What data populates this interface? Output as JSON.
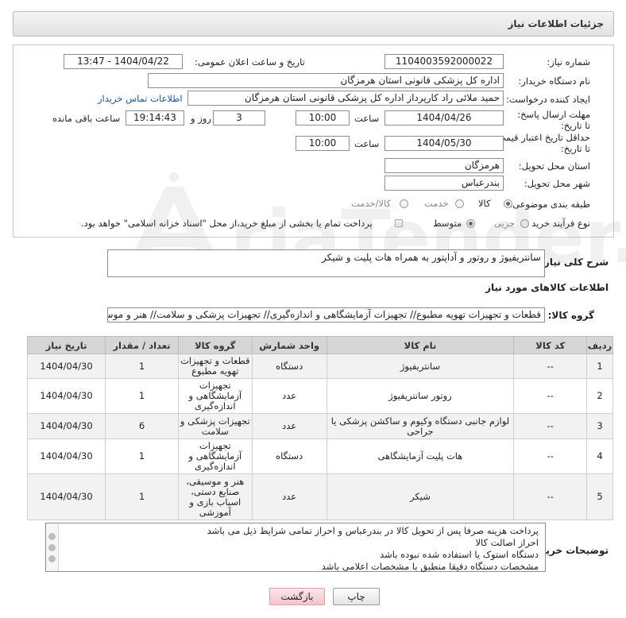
{
  "header": {
    "title": "جزئیات اطلاعات نیاز"
  },
  "form": {
    "need_number_label": "شماره نیاز:",
    "need_number": "1104003592000022",
    "announce_label": "تاریخ و ساعت اعلان عمومی:",
    "announce_value": "1404/04/22 - 13:47",
    "buyer_org_label": "نام دستگاه خریدار:",
    "buyer_org": "اداره کل پزشکی قانونی استان هرمزگان",
    "creator_label": "ایجاد کننده درخواست:",
    "creator": "حمید ملائی راد کارپرداز اداره کل پزشکی قانونی استان هرمزگان",
    "buyer_contact_link": "اطلاعات تماس خریدار",
    "reply_deadline_label": "مهلت ارسال پاسخ: تا تاریخ:",
    "reply_date": "1404/04/26",
    "time_label": "ساعت",
    "reply_time": "10:00",
    "days_value": "3",
    "days_label": "روز و",
    "remaining_time": "19:14:43",
    "remaining_label": "ساعت باقی مانده",
    "validity_label": "حداقل تاریخ اعتبار قیمت: تا تاریخ:",
    "validity_date": "1404/05/30",
    "validity_time": "10:00",
    "province_label": "استان محل تحویل:",
    "province": "هرمزگان",
    "city_label": "شهر محل تحویل:",
    "city": "بندرعباس",
    "category_label": "طبقه بندی موضوعی:",
    "category_options": [
      "کالا",
      "خدمت",
      "کالا/خدمت"
    ],
    "purchase_type_label": "نوع فرآیند خرید :",
    "purchase_type_options": [
      "جزیی",
      "متوسط"
    ],
    "payment_note": "پرداخت تمام یا بخشی از مبلغ خرید،از محل \"اسناد خزانه اسلامی\" خواهد بود."
  },
  "summary": {
    "label": "شرح کلی نیاز:",
    "text": "سانتریفیوژ و روتور و آداپتور به همراه هات پلیت و شیکر"
  },
  "goods": {
    "section_title": "اطلاعات کالاهای مورد نیاز",
    "group_label": "گروه کالا:",
    "group_value": "قطعات و تجهیزات تهویه مطبوع// تجهیزات آزمایشگاهی و اندازه‌گیری// تجهیزات پزشکی و سلامت// هنر و موس"
  },
  "table": {
    "headers": [
      "ردیف",
      "کد کالا",
      "نام کالا",
      "واحد شمارش",
      "گروه کالا",
      "تعداد / مقدار",
      "تاریخ نیاز"
    ],
    "rows": [
      {
        "row": "1",
        "code": "--",
        "name": "سانتریفیوژ",
        "unit": "دستگاه",
        "group": "قطعات و تجهیزات تهویه مطبوع",
        "qty": "1",
        "date": "1404/04/30"
      },
      {
        "row": "2",
        "code": "--",
        "name": "روتور سانتریفیوژ",
        "unit": "عدد",
        "group": "تجهیزات آزمایشگاهی و اندازه‌گیری",
        "qty": "1",
        "date": "1404/04/30"
      },
      {
        "row": "3",
        "code": "--",
        "name": "لوازم جانبی دستگاه وکیوم و ساکشن پزشکی یا جراحی",
        "unit": "عدد",
        "group": "تجهیزات پزشکی و سلامت",
        "qty": "6",
        "date": "1404/04/30"
      },
      {
        "row": "4",
        "code": "--",
        "name": "هات پلیت آزمایشگاهی",
        "unit": "دستگاه",
        "group": "تجهیزات آزمایشگاهی و اندازه‌گیری",
        "qty": "1",
        "date": "1404/04/30"
      },
      {
        "row": "5",
        "code": "--",
        "name": "شیکر",
        "unit": "عدد",
        "group": "هنر و موسیقی، صنایع دستی، اسباب بازی و آموزشی",
        "qty": "1",
        "date": "1404/04/30"
      }
    ]
  },
  "notes": {
    "label": "توضیحات خریدار:",
    "lines": [
      "پرداخت هزینه صرفا پس از تحویل کالا در بندرعباس و احراز تمامی شرایط ذیل می باشد",
      "احراز اصالت کالا",
      "دستگاه استوک یا استفاده شده نبوده باشد",
      "مشخصات دستگاه دقیقا منطبق با مشخصات اعلامی باشد"
    ]
  },
  "buttons": {
    "print": "چاپ",
    "back": "بازگشت"
  },
  "watermark_text": "AriaTender.neT"
}
